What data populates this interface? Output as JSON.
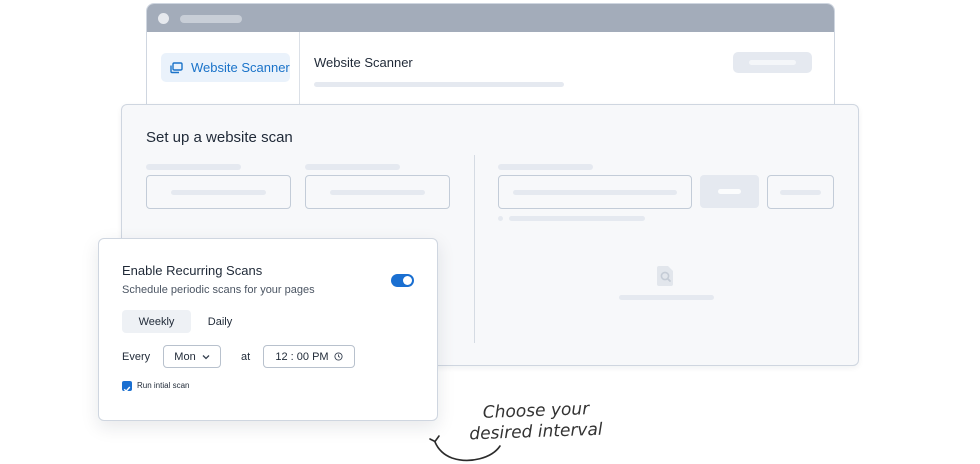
{
  "nav": {
    "item_label": "Website Scanner"
  },
  "header": {
    "title": "Website Scanner"
  },
  "setup_panel": {
    "title": "Set up a website scan"
  },
  "recurring_card": {
    "title": "Enable Recurring Scans",
    "subtitle": "Schedule periodic scans for your pages",
    "toggle_on": true,
    "frequency_options": [
      "Weekly",
      "Daily"
    ],
    "selected_frequency": "Weekly",
    "every_label": "Every",
    "day_value": "Mon",
    "at_label": "at",
    "time_value": "12 : 00 PM",
    "run_initial_label": "Run intial scan",
    "run_initial_checked": true
  },
  "annotation": {
    "text_line1": "Choose your",
    "text_line2": "desired interval"
  },
  "colors": {
    "accent": "#1a6fd1",
    "nav_text": "#1a73c9",
    "placeholder": "#e5e9f0",
    "titlebar": "#a3acba"
  }
}
